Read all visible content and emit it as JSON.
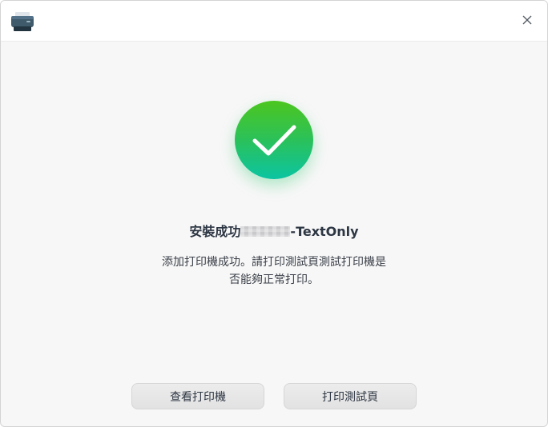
{
  "window": {
    "app_icon": "printer-icon",
    "close_icon": "close-icon"
  },
  "status": {
    "icon": "checkmark-icon",
    "colors": {
      "gradient_top": "#4cc61f",
      "gradient_bottom": "#0bc4a2"
    }
  },
  "title": {
    "prefix": "安裝成功",
    "suffix": "-TextOnly"
  },
  "message": {
    "line1": "添加打印機成功。請打印測試頁測試打印機是",
    "line2": "否能夠正常打印。"
  },
  "buttons": {
    "view_printer": "查看打印機",
    "print_test_page": "打印測試頁"
  }
}
